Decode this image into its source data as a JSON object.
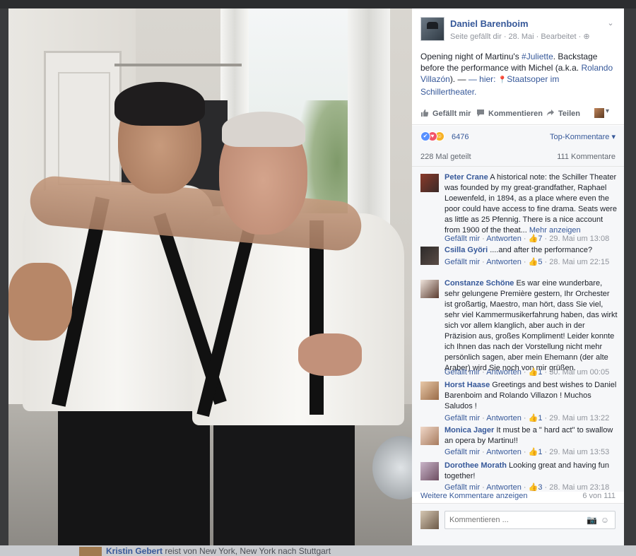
{
  "background_footer": {
    "text_name": "Kristin Gebert",
    "text_rest": " reist von New York, New York nach Stuttgart"
  },
  "post": {
    "author": "Daniel Barenboim",
    "meta": "Seite gefällt dir · 28. Mai · Bearbeitet · ",
    "globe_icon": "⊕",
    "text_intro": "Opening night of Martinu's ",
    "hashtag": "#Juliette",
    "text_middle": ". Backstage before the performance with Michel (a.k.a. ",
    "mention": "Rolando Villazón",
    "text_after": "). — ",
    "location_prefix": "— hier: ",
    "location_icon": "📍",
    "location": "Staatsoper im Schillertheater."
  },
  "actions": {
    "like": "Gefällt mir",
    "comment": "Kommentieren",
    "share": "Teilen",
    "caret": "▾"
  },
  "reactions": {
    "count": "6476",
    "sort": "Top-Kommentare ▾",
    "colors": {
      "like": "#5890ff",
      "love": "#f25268",
      "haha": "#f7b125"
    }
  },
  "stats": {
    "shares": "228 Mal geteilt",
    "comments": "111 Kommentare"
  },
  "comments": [
    {
      "name": "Peter Crane",
      "text": " A historical note: the Schiller Theater was founded by my great-grandfather, Raphael Loewenfeld, in 1894, as a place where even the poor could have access to fine drama. Seats were as little as 25 Pfennig. There is a nice account from 1900 of the theat... ",
      "more": "Mehr anzeigen",
      "like": "Gefällt mir",
      "reply": "Antworten",
      "likes": "7",
      "time": "29. Mai um 13:08"
    },
    {
      "name": "Csilla Györi",
      "text": " ....and after the performance?",
      "more": "",
      "like": "Gefällt mir",
      "reply": "Antworten",
      "likes": "5",
      "time": "28. Mai um 22:15"
    },
    {
      "name": "Constanze Schöne",
      "text": " Es war eine wunderbare, sehr gelungene Première gestern, Ihr Orchester ist großartig, Maestro, man hört, dass Sie viel, sehr viel Kammermusikerfahrung haben, das wirkt sich vor allem klanglich, aber auch in der Präzision aus, großes Kompliment! Leider konnte ich Ihnen das nach der Vorstellung nicht mehr persönlich sagen, aber mein Ehemann (der alte Araber) wird Sie noch von mir grüßen.",
      "more": "",
      "like": "Gefällt mir",
      "reply": "Antworten",
      "likes": "1",
      "time": "30. Mai um 00:05"
    },
    {
      "name": "Horst Haase",
      "text": " Greetings and best wishes to Daniel Barenboim and Rolando Villazon ! Muchos Saludos !",
      "more": "",
      "like": "Gefällt mir",
      "reply": "Antworten",
      "likes": "1",
      "time": "29. Mai um 13:22"
    },
    {
      "name": "Monica Jager",
      "text": " It must be a \" hard act\" to swallow an opera by Martinu!!",
      "more": "",
      "like": "Gefällt mir",
      "reply": "Antworten",
      "likes": "1",
      "time": "29. Mai um 13:53"
    },
    {
      "name": "Dorothee Morath",
      "text": " Looking great and having fun together!",
      "more": "",
      "like": "Gefällt mir",
      "reply": "Antworten",
      "likes": "3",
      "time": "28. Mai um 23:18"
    }
  ],
  "footer": {
    "more_comments": "Weitere Kommentare anzeigen",
    "page_count": "6 von 111",
    "composer_placeholder": "Kommentieren ..."
  }
}
